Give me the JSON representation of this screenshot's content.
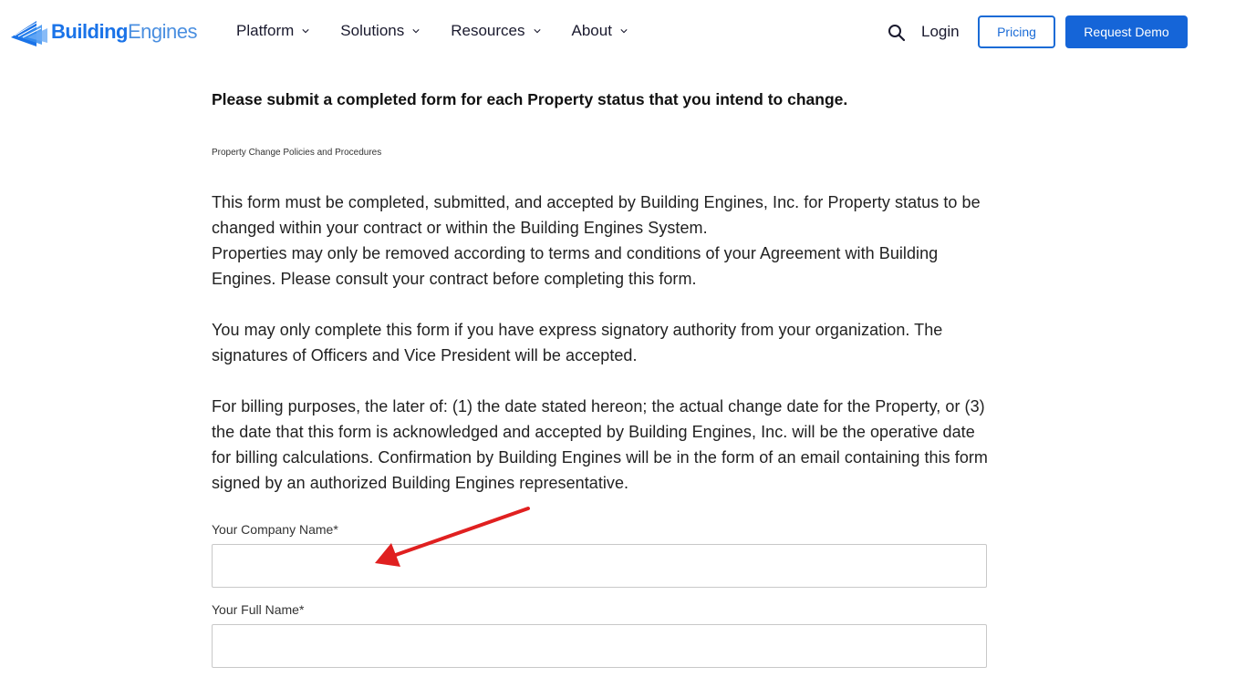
{
  "header": {
    "logo": {
      "part1": "Building",
      "part2": "Engines",
      "icon": "building-engines-logo-icon"
    },
    "nav": [
      {
        "label": "Platform"
      },
      {
        "label": "Solutions"
      },
      {
        "label": "Resources"
      },
      {
        "label": "About"
      }
    ],
    "search_icon": "search-icon",
    "login_label": "Login",
    "pricing_label": "Pricing",
    "demo_label": "Request Demo",
    "accent_color": "#1565d8"
  },
  "content": {
    "heading": "Please submit a completed form for each Property status that you intend to change.",
    "small_title": "Property Change Policies and Procedures",
    "paragraph1_line1": "This form must be completed, submitted, and accepted by Building Engines, Inc. for Property status to be changed within your contract or within the Building Engines System.",
    "paragraph1_line2": "Properties may only be removed according to terms and conditions of your Agreement with Building Engines. Please consult your contract before completing this form.",
    "paragraph2": "You may only complete this form if you have express signatory authority from your organization. The signatures of Officers and Vice President will be accepted.",
    "paragraph3": "For billing purposes, the later of: (1) the date stated hereon; the actual change date for the Property, or (3) the date that this form is acknowledged and accepted by Building Engines, Inc. will be the operative date for billing calculations. Confirmation by Building Engines will be in the form of an email containing this form signed by an authorized Building Engines representative."
  },
  "form": {
    "company_label": "Your Company Name*",
    "company_value": "",
    "fullname_label": "Your Full Name*",
    "fullname_value": ""
  },
  "annotation": {
    "arrow_color": "#e02020"
  }
}
